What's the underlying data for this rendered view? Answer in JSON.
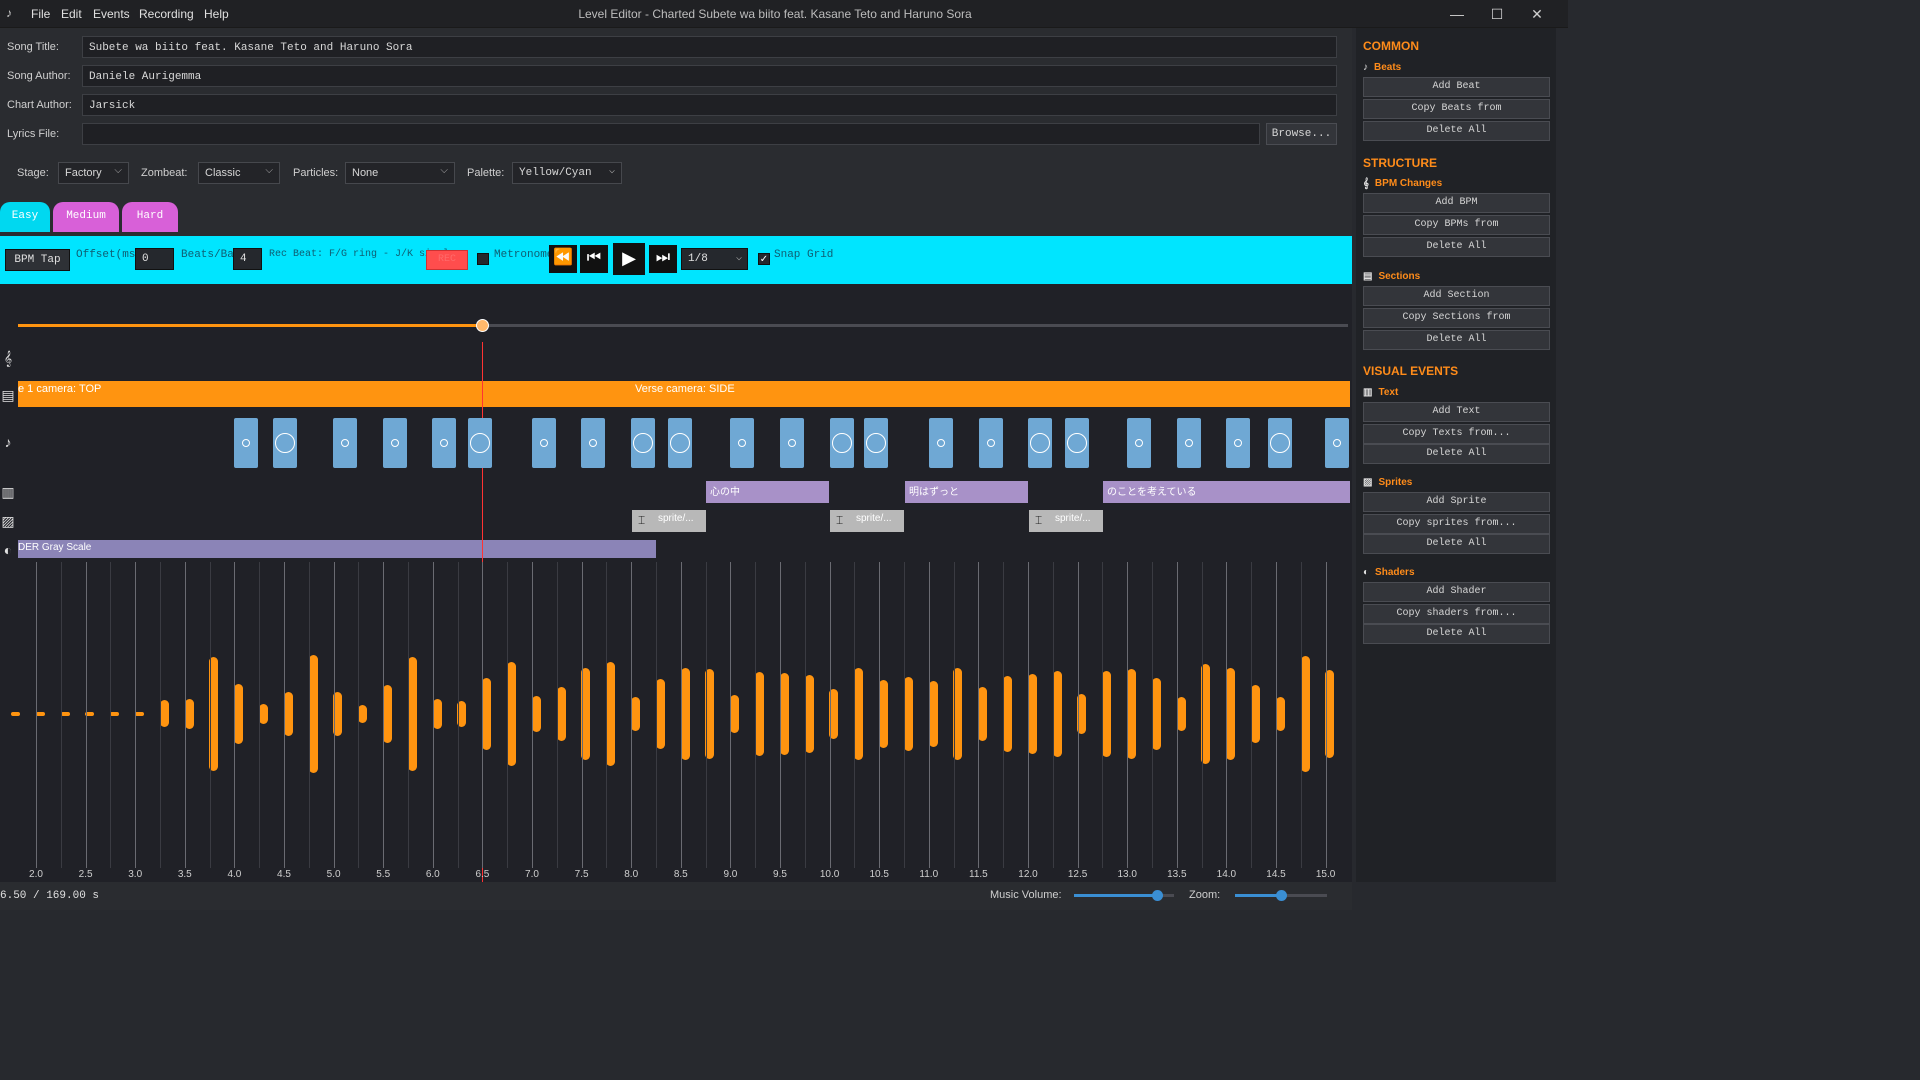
{
  "titlebar": {
    "menus": [
      "File",
      "Edit",
      "Events",
      "Recording",
      "Help"
    ],
    "title": "Level Editor - Charted Subete wa biito feat. Kasane Teto and Haruno Sora"
  },
  "fields": {
    "song_title_label": "Song Title:",
    "song_title": "Subete wa biito feat. Kasane Teto and Haruno Sora",
    "song_author_label": "Song Author:",
    "song_author": "Daniele Aurigemma",
    "chart_author_label": "Chart Author:",
    "chart_author": "Jarsick",
    "lyrics_file_label": "Lyrics File:",
    "lyrics_file": "",
    "browse": "Browse..."
  },
  "selects": {
    "stage_label": "Stage:",
    "stage": "Factory",
    "zombeat_label": "Zombeat:",
    "zombeat": "Classic",
    "particles_label": "Particles:",
    "particles": "None",
    "palette_label": "Palette:",
    "palette": "Yellow/Cyan"
  },
  "difficulty_tabs": [
    {
      "label": "Easy",
      "color": "#00d8f0"
    },
    {
      "label": "Medium",
      "color": "#d860d8"
    },
    {
      "label": "Hard",
      "color": "#d860d8"
    }
  ],
  "toolbar": {
    "bpm_tap": "BPM Tap",
    "offset_label": "Offset(ms):",
    "offset": "0",
    "beats_bar_label": "Beats/Bar:",
    "beats_bar": "4",
    "rec_beat": "Rec Beat: F/G ring - J/K single",
    "rec": "REC",
    "metronome": "Metronome",
    "grid_division": "1/8",
    "snap_grid": "Snap Grid"
  },
  "timeline": {
    "seek_progress": 0.349,
    "sections": [
      {
        "label": "e 1  camera: TOP"
      },
      {
        "label": "Verse  camera: SIDE"
      }
    ],
    "lyrics": [
      "心の中",
      "明はずっと",
      "のことを考えている"
    ],
    "sprites": [
      "sprite/...",
      "sprite/...",
      "sprite/..."
    ],
    "shader": "DER  Gray Scale",
    "ticks": [
      "2.0",
      "2.5",
      "3.0",
      "3.5",
      "4.0",
      "4.5",
      "5.0",
      "5.5",
      "6.0",
      "6.5",
      "7.0",
      "7.5",
      "8.0",
      "8.5",
      "9.0",
      "9.5",
      "10.0",
      "10.5",
      "11.0",
      "11.5",
      "12.0",
      "12.5",
      "13.0",
      "13.5",
      "14.0",
      "14.5",
      "15.0"
    ]
  },
  "status": {
    "time": "6.50 / 169.00 s",
    "music_volume_label": "Music Volume:",
    "music_volume": 0.83,
    "zoom_label": "Zoom:",
    "zoom": 0.5
  },
  "sidebar": {
    "common": "COMMON",
    "beats": "Beats",
    "add_beat": "Add Beat",
    "copy_beats": "Copy Beats from",
    "delete_beats": "Delete All",
    "structure": "STRUCTURE",
    "bpm_changes": "BPM Changes",
    "add_bpm": "Add BPM",
    "copy_bpms": "Copy BPMs from",
    "delete_bpms": "Delete All",
    "sections": "Sections",
    "add_section": "Add Section",
    "copy_sections": "Copy Sections from",
    "delete_sections": "Delete All",
    "visual_events": "VISUAL EVENTS",
    "text": "Text",
    "add_text": "Add Text",
    "copy_texts": "Copy Texts from...",
    "delete_texts": "Delete All",
    "sprites": "Sprites",
    "add_sprite": "Add Sprite",
    "copy_sprites": "Copy sprites from...",
    "delete_sprites": "Delete All",
    "shaders": "Shaders",
    "add_shader": "Add Shader",
    "copy_shaders": "Copy shaders from...",
    "delete_shaders": "Delete All"
  }
}
